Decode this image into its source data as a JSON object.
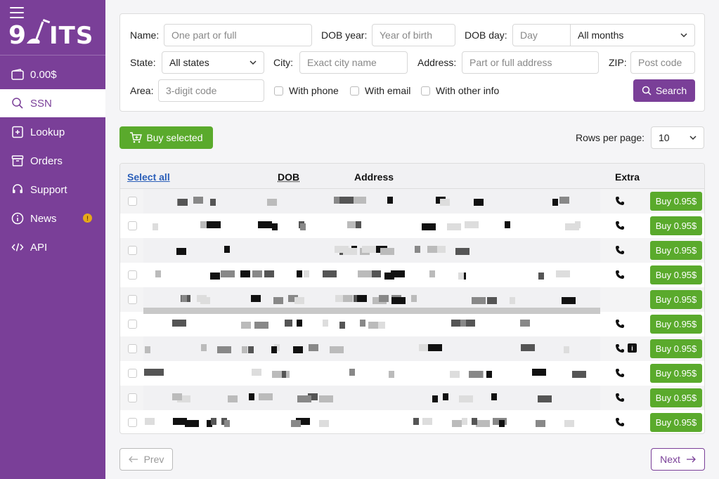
{
  "sidebar": {
    "logo": "9ITS",
    "balance": "0.00$",
    "items": [
      {
        "label": "SSN",
        "icon": "search-icon",
        "active": true
      },
      {
        "label": "Lookup",
        "icon": "lookup-icon"
      },
      {
        "label": "Orders",
        "icon": "orders-icon"
      },
      {
        "label": "Support",
        "icon": "headset-icon"
      },
      {
        "label": "News",
        "icon": "info-icon",
        "badge": "!"
      },
      {
        "label": "API",
        "icon": "code-icon"
      }
    ]
  },
  "filters": {
    "name_label": "Name:",
    "name_placeholder": "One part or full",
    "dob_year_label": "DOB year:",
    "dob_year_placeholder": "Year of birth",
    "dob_day_label": "DOB day:",
    "dob_day_placeholder": "Day",
    "month_value": "All months",
    "state_label": "State:",
    "state_value": "All states",
    "city_label": "City:",
    "city_placeholder": "Exact city name",
    "address_label": "Address:",
    "address_placeholder": "Part or full address",
    "zip_label": "ZIP:",
    "zip_placeholder": "Post code",
    "area_label": "Area:",
    "area_placeholder": "3-digit code",
    "with_phone": "With phone",
    "with_email": "With email",
    "with_other": "With other info",
    "search_button": "Search"
  },
  "toolbar": {
    "buy_selected": "Buy selected",
    "rows_per_page_label": "Rows per page:",
    "rows_per_page_value": "10"
  },
  "table": {
    "headers": {
      "select_all": "Select all",
      "dob": "DOB",
      "address": "Address",
      "extra": "Extra"
    },
    "rows": [
      {
        "buy": "Buy 0.95$",
        "phone": true,
        "info": false
      },
      {
        "buy": "Buy 0.95$",
        "phone": true,
        "info": false
      },
      {
        "buy": "Buy 0.95$",
        "phone": true,
        "info": false
      },
      {
        "buy": "Buy 0.95$",
        "phone": true,
        "info": false
      },
      {
        "buy": "Buy 0.95$",
        "phone": false,
        "info": false
      },
      {
        "buy": "Buy 0.95$",
        "phone": true,
        "info": false
      },
      {
        "buy": "Buy 0.95$",
        "phone": true,
        "info": true
      },
      {
        "buy": "Buy 0.95$",
        "phone": true,
        "info": false
      },
      {
        "buy": "Buy 0.95$",
        "phone": true,
        "info": false
      },
      {
        "buy": "Buy 0.95$",
        "phone": true,
        "info": false
      }
    ]
  },
  "pagination": {
    "prev": "Prev",
    "next": "Next"
  },
  "colors": {
    "brand": "#7a3f98",
    "buy": "#5aaa2c",
    "badge": "#e6a91a"
  }
}
